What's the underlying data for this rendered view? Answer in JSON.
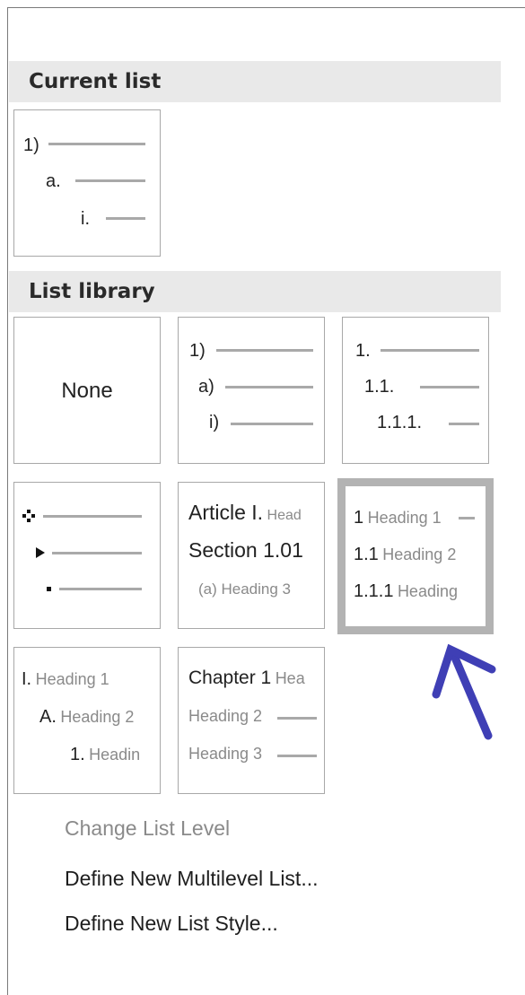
{
  "sections": {
    "current_list": "Current list",
    "list_library": "List library"
  },
  "current_list": {
    "level1": "1)",
    "level2": "a.",
    "level3": "i."
  },
  "library": {
    "none_label": "None",
    "paren_list": {
      "l1": "1)",
      "l2": "a)",
      "l3": "i)"
    },
    "decimal_list": {
      "l1": "1.",
      "l2": "1.1.",
      "l3": "1.1.1."
    },
    "article_list": {
      "l1_prefix": "Article I.",
      "l1_text": "Head",
      "l2": "Section 1.01",
      "l3": "(a) Heading 3"
    },
    "heading_numbered_list": {
      "l1_num": "1",
      "l1_text": "Heading 1",
      "l2_num": "1.1",
      "l2_text": "Heading 2",
      "l3_num": "1.1.1",
      "l3_text": "Heading"
    },
    "outline_list": {
      "l1_num": "I.",
      "l1_text": "Heading 1",
      "l2_num": "A.",
      "l2_text": "Heading 2",
      "l3_num": "1.",
      "l3_text": "Headin"
    },
    "chapter_list": {
      "l1_prefix": "Chapter 1",
      "l1_text": "Hea",
      "l2": "Heading 2",
      "l3": "Heading 3"
    },
    "bullet_list": {
      "l1_icon": "diamond-dots-bullet-icon",
      "l2_icon": "arrow-bullet-icon",
      "l3_icon": "square-bullet-icon"
    }
  },
  "menu": {
    "change_level": "Change List Level",
    "define_multilevel": "Define New Multilevel List...",
    "define_style": "Define New List Style..."
  },
  "annotation": {
    "arrow_color": "#3f3fb5"
  }
}
